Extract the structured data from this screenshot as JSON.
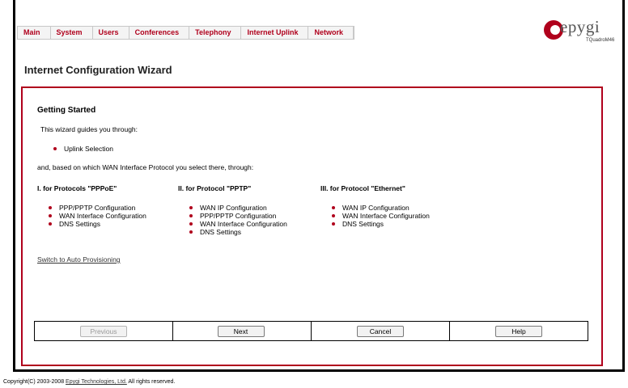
{
  "nav": {
    "items": [
      "Main",
      "System",
      "Users",
      "Conferences",
      "Telephony",
      "Internet Uplink",
      "Network"
    ]
  },
  "logo": {
    "brand": "epygi",
    "model": "TQuadroM46"
  },
  "page_title": "Internet Configuration Wizard",
  "section_title": "Getting Started",
  "intro": "This wizard guides you through:",
  "uplink_item": "Uplink Selection",
  "based_text": "and, based on which WAN Interface Protocol you select there, through:",
  "columns": [
    {
      "heading": "I. for Protocols \"PPPoE\"",
      "items": [
        "PPP/PPTP Configuration",
        "WAN Interface Configuration",
        "DNS Settings"
      ]
    },
    {
      "heading": "II. for Protocol \"PPTP\"",
      "items": [
        "WAN IP Configuration",
        "PPP/PPTP Configuration",
        "WAN Interface Configuration",
        "DNS Settings"
      ]
    },
    {
      "heading": "III. for Protocol \"Ethernet\"",
      "items": [
        "WAN IP Configuration",
        "WAN Interface Configuration",
        "DNS Settings"
      ]
    }
  ],
  "auto_provisioning_link": "Switch to Auto Provisioning",
  "buttons": {
    "previous": "Previous",
    "next": "Next",
    "cancel": "Cancel",
    "help": "Help"
  },
  "footer": {
    "prefix": "Copyright(C) 2003-2008 ",
    "company_link": "Epygi Technologies, Ltd.",
    "suffix": " All rights reserved."
  },
  "colors": {
    "accent": "#b0001c",
    "border": "#000000"
  }
}
